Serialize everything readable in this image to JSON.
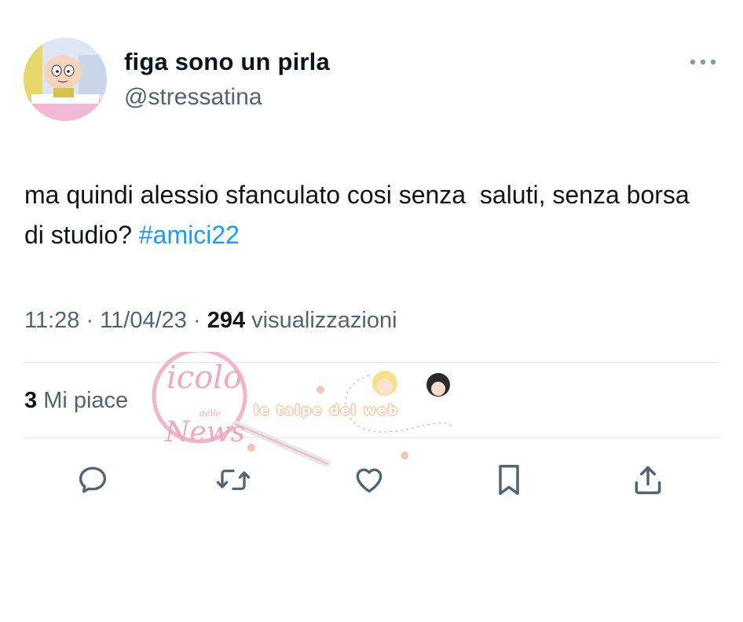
{
  "tweet": {
    "author": {
      "display_name": "figa sono un pirla",
      "handle": "@stressatina",
      "avatar_icon": "cartoon-baby-avatar"
    },
    "more_icon": "more-dots-icon",
    "text": "ma quindi alessio sfanculato cosi senza  saluti, senza borsa di studio? ",
    "hashtag": "#amici22",
    "time": "11:28",
    "separator": " · ",
    "date": "11/04/23",
    "views_count": "294",
    "views_label": "visualizzazioni",
    "likes_count": "3",
    "likes_label": "Mi piace"
  },
  "actions": {
    "reply_icon": "reply-icon",
    "retweet_icon": "retweet-icon",
    "like_icon": "heart-icon",
    "bookmark_icon": "bookmark-icon",
    "share_icon": "share-icon"
  },
  "watermark": {
    "line1": "icolo",
    "line2": "delle",
    "line3": "News",
    "bubble_text": "le talpe del web"
  },
  "colors": {
    "text": "#0f1419",
    "secondary": "#536471",
    "hashtag": "#1d9bf0",
    "divider": "#e4e8eb",
    "watermark": "#f2a7c0"
  }
}
